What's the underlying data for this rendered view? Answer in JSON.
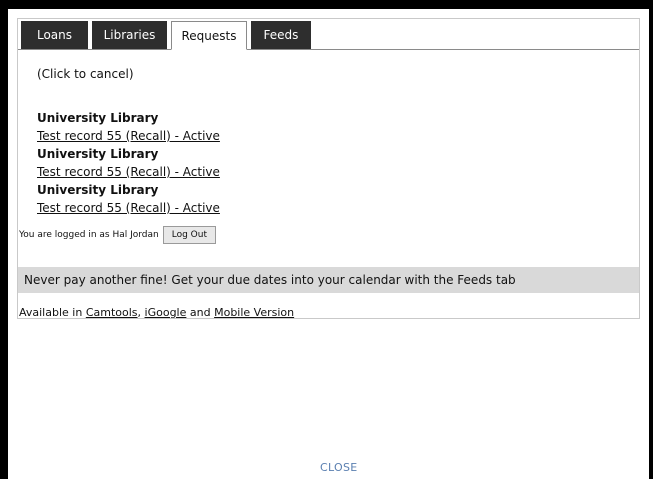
{
  "tabs": [
    {
      "label": "Loans"
    },
    {
      "label": "Libraries"
    },
    {
      "label": "Requests"
    },
    {
      "label": "Feeds"
    }
  ],
  "requests": {
    "cancel_hint": "(Click to cancel)",
    "items": [
      {
        "library": "University Library",
        "record": "Test record 55 (Recall) - Active"
      },
      {
        "library": "University Library",
        "record": "Test record 55 (Recall) - Active"
      },
      {
        "library": "University Library",
        "record": "Test record 55 (Recall) - Active"
      }
    ]
  },
  "user": {
    "logged_in_text": "You are logged in as Hal Jordan",
    "logout_label": "Log Out"
  },
  "promo": {
    "text": "Never pay another fine! Get your due dates into your calendar with the Feeds tab"
  },
  "availability": {
    "prefix": "Available in",
    "link1": "Camtools",
    "sep1": ",",
    "link2": "iGoogle",
    "sep2": "and",
    "link3": "Mobile Version"
  },
  "footer": {
    "close_label": "CLOSE"
  }
}
